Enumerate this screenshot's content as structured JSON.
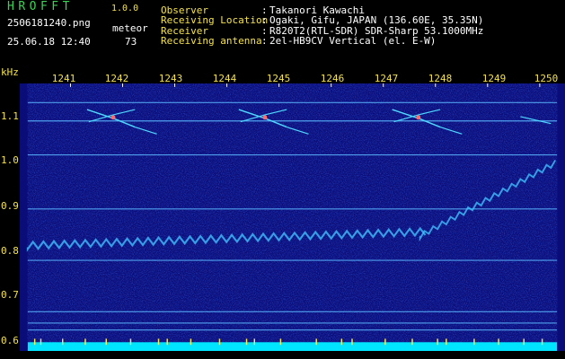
{
  "header": {
    "app_name": "HROFFT",
    "version": "1.0.0",
    "filename": "2506181240.png",
    "mode": "meteor",
    "datetime": "25.06.18 12:40",
    "count": "73",
    "fields": [
      {
        "label": "Observer",
        "value": "Takanori Kawachi"
      },
      {
        "label": "Receiving Location",
        "value": "Ogaki, Gifu, JAPAN (136.60E, 35.35N)"
      },
      {
        "label": "Receiver",
        "value": "R820T2(RTL-SDR) SDR-Sharp 53.1000MHz"
      },
      {
        "label": "Receiving antenna",
        "value": "2el-HB9CV Vertical (el. E-W)"
      }
    ],
    "separator": ":"
  },
  "axis": {
    "y_unit": "kHz",
    "x_ticks": [
      "1241",
      "1242",
      "1243",
      "1244",
      "1245",
      "1246",
      "1247",
      "1248",
      "1249",
      "1250"
    ],
    "y_ticks": [
      "1.1",
      "1.0",
      "0.9",
      "0.8",
      "0.7",
      "0.6"
    ]
  },
  "colors": {
    "background": "#000000",
    "spectrum_bg": "#0a0c78",
    "label_green": "#39d353",
    "label_yellow": "#f4e24a",
    "trace_cyan": "#4fd8ff",
    "bottom_band": "#00e5ff"
  }
}
